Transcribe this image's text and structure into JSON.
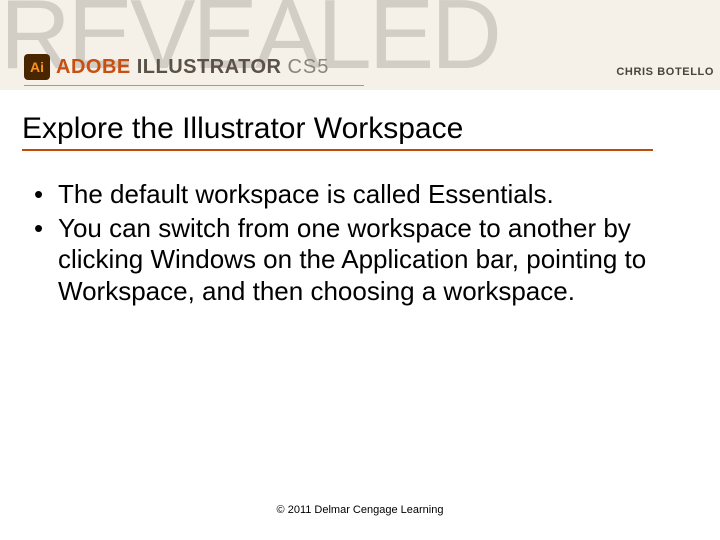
{
  "banner": {
    "revealed_text": "REVEALED",
    "logo_letters": "Ai",
    "brand_adobe": "ADOBE",
    "brand_product": "ILLUSTRATOR",
    "brand_version": "CS5",
    "author": "CHRIS BOTELLO"
  },
  "heading": "Explore the Illustrator Workspace",
  "bullets": [
    "The default workspace is called Essentials.",
    "You can switch from one workspace to another by clicking Windows on the Application bar, pointing to Workspace, and then choosing a workspace."
  ],
  "footer": "© 2011 Delmar Cengage Learning"
}
